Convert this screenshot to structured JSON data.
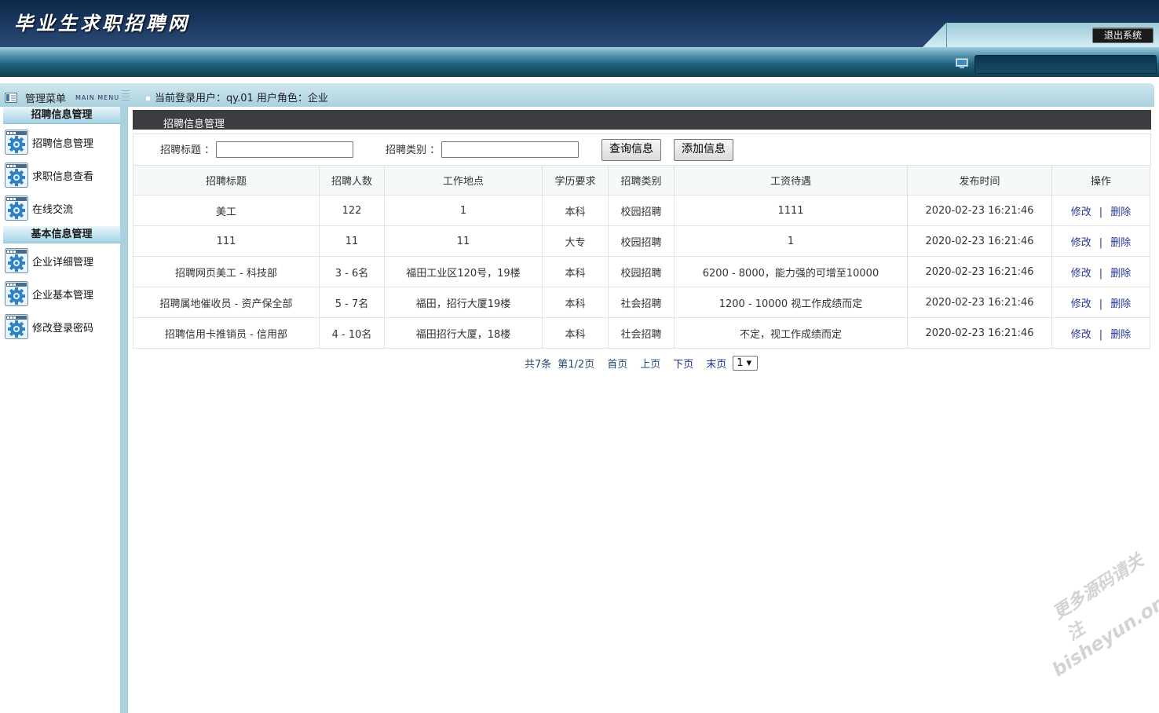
{
  "header": {
    "site_title": "毕业生求职招聘网",
    "logout_label": "退出系统"
  },
  "menubar": {
    "title": "管理菜单",
    "title_en": "MAIN MENU",
    "user_info": "当前登录用户：qy.01  用户角色：企业"
  },
  "sidebar": {
    "groups": [
      {
        "label": "招聘信息管理",
        "items": [
          {
            "label": "招聘信息管理"
          },
          {
            "label": "求职信息查看"
          },
          {
            "label": "在线交流"
          }
        ]
      },
      {
        "label": "基本信息管理",
        "items": [
          {
            "label": "企业详细管理"
          },
          {
            "label": "企业基本管理"
          },
          {
            "label": "修改登录密码"
          }
        ]
      }
    ]
  },
  "content": {
    "section_title": "招聘信息管理",
    "search": {
      "title_label": "招聘标题 ：",
      "title_value": "",
      "category_label": "招聘类别 ：",
      "category_value": "",
      "query_button": "查询信息",
      "add_button": "添加信息"
    },
    "table": {
      "columns": [
        "招聘标题",
        "招聘人数",
        "工作地点",
        "学历要求",
        "招聘类别",
        "工资待遇",
        "发布时间",
        "操作"
      ],
      "rows": [
        [
          "美工",
          "122",
          "1",
          "本科",
          "校园招聘",
          "1111",
          "2020-02-23 16:21:46"
        ],
        [
          "111",
          "11",
          "11",
          "大专",
          "校园招聘",
          "1",
          "2020-02-23 16:21:46"
        ],
        [
          "招聘网页美工 - 科技部",
          "3 - 6名",
          "福田工业区120号，19楼",
          "本科",
          "校园招聘",
          "6200 - 8000，能力强的可增至10000",
          "2020-02-23 16:21:46"
        ],
        [
          "招聘属地催收员 - 资产保全部",
          "5 - 7名",
          "福田，招行大厦19楼",
          "本科",
          "社会招聘",
          "1200 - 10000 视工作成绩而定",
          "2020-02-23 16:21:46"
        ],
        [
          "招聘信用卡推销员 - 信用部",
          "4 - 10名",
          "福田招行大厦，18楼",
          "本科",
          "社会招聘",
          "不定，视工作成绩而定",
          "2020-02-23 16:21:46"
        ]
      ],
      "edit_label": "修改",
      "separator": "|",
      "delete_label": "删除"
    },
    "pager": {
      "total": "共7条",
      "page_info": "第1/2页",
      "first": "首页",
      "prev": "上页",
      "next": "下页",
      "last": "末页",
      "selected_page": "1 ▾"
    }
  },
  "watermark": {
    "line1": "更多源码请关注",
    "line2": "bisheyun.org"
  },
  "colors": {
    "header_dark": "#1d3a64",
    "nav_light": "#a9d1de",
    "title_bar": "#3b3d41",
    "link": "#24358f"
  }
}
